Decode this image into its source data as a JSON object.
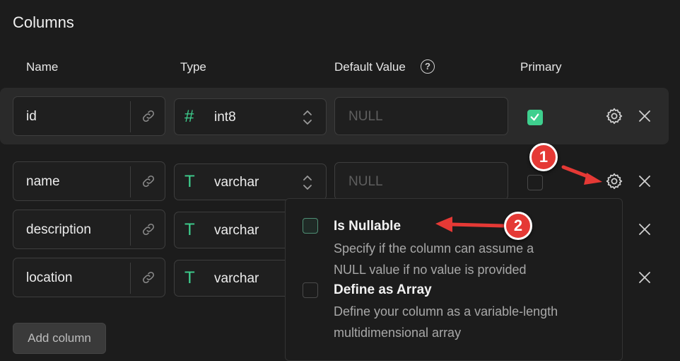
{
  "section_title": "Columns",
  "headers": {
    "name": "Name",
    "type": "Type",
    "default_value": "Default Value",
    "primary": "Primary"
  },
  "columns": [
    {
      "name": "id",
      "type_icon": "#",
      "type": "int8",
      "default_placeholder": "NULL",
      "primary": true
    },
    {
      "name": "name",
      "type_icon": "T",
      "type": "varchar",
      "default_placeholder": "NULL",
      "primary": false
    },
    {
      "name": "description",
      "type_icon": "T",
      "type": "varchar"
    },
    {
      "name": "location",
      "type_icon": "T",
      "type": "varchar"
    }
  ],
  "add_column_label": "Add column",
  "popover": {
    "options": [
      {
        "title": "Is Nullable",
        "desc1": "Specify if the column can assume a",
        "desc2": "NULL value if no value is provided"
      },
      {
        "title": "Define as Array",
        "desc1": "Define your column as a variable-length",
        "desc2": "multidimensional array"
      }
    ]
  },
  "annotations": {
    "badge1": "1",
    "badge2": "2"
  },
  "colors": {
    "accent": "#3ecf8e",
    "annotation": "#e53935",
    "background": "#1c1c1c"
  },
  "icons": [
    "help-icon",
    "link-icon",
    "chevron-updown-icon",
    "gear-icon",
    "close-icon"
  ]
}
